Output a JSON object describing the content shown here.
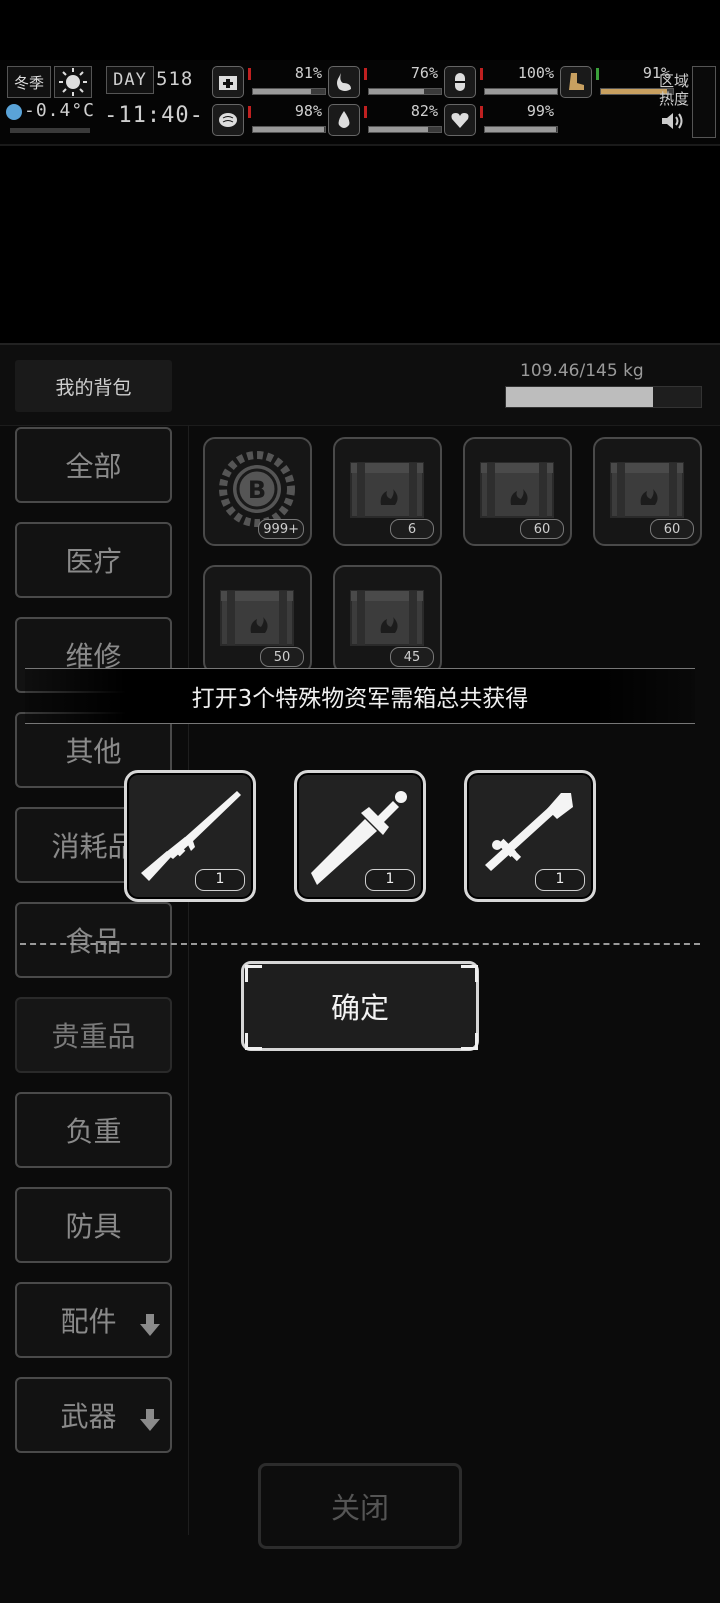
{
  "hud": {
    "season": "冬季",
    "temperature": "-0.4°C",
    "day_label": "DAY",
    "day_number": "518",
    "time": "-11:40-",
    "region_heat_label": "区域热度",
    "stats": [
      {
        "name": "health",
        "icon": "medkit-icon",
        "value": "81%",
        "fill": 0.81
      },
      {
        "name": "hunger",
        "icon": "stomach-icon",
        "value": "76%",
        "fill": 0.76
      },
      {
        "name": "stamina",
        "icon": "pill-icon",
        "value": "100%",
        "fill": 1.0
      },
      {
        "name": "mood",
        "icon": "brain-icon",
        "value": "98%",
        "fill": 0.98
      },
      {
        "name": "thirst",
        "icon": "water-drop-icon",
        "value": "82%",
        "fill": 0.82
      },
      {
        "name": "heart",
        "icon": "heart-icon",
        "value": "99%",
        "fill": 0.99
      },
      {
        "name": "energy",
        "icon": "boot-icon",
        "value": "91%",
        "fill": 0.91
      }
    ]
  },
  "backpack": {
    "title": "我的背包",
    "weight": "109.46/145 kg",
    "weight_fill": 0.755,
    "categories": [
      "全部",
      "医疗",
      "维修",
      "其他",
      "消耗品",
      "食品",
      "贵重品",
      "负重",
      "防具",
      "配件",
      "武器"
    ],
    "items": [
      {
        "icon": "bitcoin-coin-icon",
        "count": "999+"
      },
      {
        "icon": "supply-crate-icon",
        "count": "6"
      },
      {
        "icon": "supply-crate-icon",
        "count": "60"
      },
      {
        "icon": "supply-crate-icon",
        "count": "60"
      },
      {
        "icon": "supply-crate-icon",
        "count": "50"
      },
      {
        "icon": "supply-crate-icon",
        "count": "45"
      }
    ],
    "close_label": "关闭"
  },
  "reward_dialog": {
    "message": "打开3个特殊物资军需箱总共获得",
    "rewards": [
      {
        "icon": "rifle-icon",
        "count": "1"
      },
      {
        "icon": "sword-icon",
        "count": "1"
      },
      {
        "icon": "rocket-launcher-icon",
        "count": "1"
      }
    ],
    "confirm_label": "确定"
  },
  "colors": {
    "background": "#000000",
    "panel": "#0b0b0b",
    "text_light": "#f0f0f0",
    "warning_red": "#c02020"
  }
}
